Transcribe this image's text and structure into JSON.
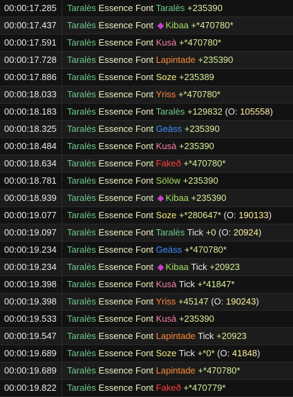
{
  "colors": {
    "Taralès": "#71c78d",
    "Kibaa": "#a6df63",
    "Kusà": "#f87fb0",
    "Lapintade": "#ff8a3a",
    "Soze": "#f6ee7d",
    "Yriss": "#ff8a3a",
    "Geäss": "#3d8eff",
    "Fakeð": "#ff4040",
    "Sölöw": "#a6df63",
    "Taralès-target": "#71c78d"
  },
  "rows": [
    {
      "time": "00:00:17.285",
      "source": "Taralès",
      "spell": "Essence Font",
      "target": "Taralès",
      "target_icon": false,
      "tick": "",
      "amount": "+235390",
      "overheal_prefix": "",
      "overheal": "",
      "overheal_suffix": ""
    },
    {
      "time": "00:00:17.437",
      "source": "Taralès",
      "spell": "Essence Font",
      "target": "Kibaa",
      "target_icon": true,
      "tick": "",
      "amount": "+*470780*",
      "overheal_prefix": "",
      "overheal": "",
      "overheal_suffix": ""
    },
    {
      "time": "00:00:17.591",
      "source": "Taralès",
      "spell": "Essence Font",
      "target": "Kusà",
      "target_icon": false,
      "tick": "",
      "amount": "+*470780*",
      "overheal_prefix": "",
      "overheal": "",
      "overheal_suffix": ""
    },
    {
      "time": "00:00:17.728",
      "source": "Taralès",
      "spell": "Essence Font",
      "target": "Lapintade",
      "target_icon": false,
      "tick": "",
      "amount": "+235390",
      "overheal_prefix": "",
      "overheal": "",
      "overheal_suffix": ""
    },
    {
      "time": "00:00:17.886",
      "source": "Taralès",
      "spell": "Essence Font",
      "target": "Soze",
      "target_icon": false,
      "tick": "",
      "amount": "+235389",
      "overheal_prefix": "",
      "overheal": "",
      "overheal_suffix": ""
    },
    {
      "time": "00:00:18.033",
      "source": "Taralès",
      "spell": "Essence Font",
      "target": "Yriss",
      "target_icon": false,
      "tick": "",
      "amount": "+*470780*",
      "overheal_prefix": "",
      "overheal": "",
      "overheal_suffix": ""
    },
    {
      "time": "00:00:18.183",
      "source": "Taralès",
      "spell": "Essence Font",
      "target": "Taralès",
      "target_icon": false,
      "tick": "",
      "amount": "+129832",
      "overheal_prefix": " (O: ",
      "overheal": "105558",
      "overheal_suffix": ")"
    },
    {
      "time": "00:00:18.325",
      "source": "Taralès",
      "spell": "Essence Font",
      "target": "Geäss",
      "target_icon": false,
      "tick": "",
      "amount": "+235390",
      "overheal_prefix": "",
      "overheal": "",
      "overheal_suffix": ""
    },
    {
      "time": "00:00:18.484",
      "source": "Taralès",
      "spell": "Essence Font",
      "target": "Kusà",
      "target_icon": false,
      "tick": "",
      "amount": "+235390",
      "overheal_prefix": "",
      "overheal": "",
      "overheal_suffix": ""
    },
    {
      "time": "00:00:18.634",
      "source": "Taralès",
      "spell": "Essence Font",
      "target": "Fakeð",
      "target_icon": false,
      "tick": "",
      "amount": "+*470780*",
      "overheal_prefix": "",
      "overheal": "",
      "overheal_suffix": ""
    },
    {
      "time": "00:00:18.781",
      "source": "Taralès",
      "spell": "Essence Font",
      "target": "Sölöw",
      "target_icon": false,
      "tick": "",
      "amount": "+235390",
      "overheal_prefix": "",
      "overheal": "",
      "overheal_suffix": ""
    },
    {
      "time": "00:00:18.939",
      "source": "Taralès",
      "spell": "Essence Font",
      "target": "Kibaa",
      "target_icon": true,
      "tick": "",
      "amount": "+235390",
      "overheal_prefix": "",
      "overheal": "",
      "overheal_suffix": ""
    },
    {
      "time": "00:00:19.077",
      "source": "Taralès",
      "spell": "Essence Font",
      "target": "Soze",
      "target_icon": false,
      "tick": "",
      "amount": "+*280647*",
      "overheal_prefix": " (O: ",
      "overheal": "190133",
      "overheal_suffix": ")"
    },
    {
      "time": "00:00:19.097",
      "source": "Taralès",
      "spell": "Essence Font",
      "target": "Taralès",
      "target_icon": false,
      "tick": "Tick",
      "amount": "+0",
      "overheal_prefix": " (O: ",
      "overheal": "20924",
      "overheal_suffix": ")"
    },
    {
      "time": "00:00:19.234",
      "source": "Taralès",
      "spell": "Essence Font",
      "target": "Geäss",
      "target_icon": false,
      "tick": "",
      "amount": "+*470780*",
      "overheal_prefix": "",
      "overheal": "",
      "overheal_suffix": ""
    },
    {
      "time": "00:00:19.234",
      "source": "Taralès",
      "spell": "Essence Font",
      "target": "Kibaa",
      "target_icon": true,
      "tick": "Tick",
      "amount": "+20923",
      "overheal_prefix": "",
      "overheal": "",
      "overheal_suffix": ""
    },
    {
      "time": "00:00:19.398",
      "source": "Taralès",
      "spell": "Essence Font",
      "target": "Kusà",
      "target_icon": false,
      "tick": "Tick",
      "amount": "+*41847*",
      "overheal_prefix": "",
      "overheal": "",
      "overheal_suffix": ""
    },
    {
      "time": "00:00:19.398",
      "source": "Taralès",
      "spell": "Essence Font",
      "target": "Yriss",
      "target_icon": false,
      "tick": "",
      "amount": "+45147",
      "overheal_prefix": " (O: ",
      "overheal": "190243",
      "overheal_suffix": ")"
    },
    {
      "time": "00:00:19.533",
      "source": "Taralès",
      "spell": "Essence Font",
      "target": "Kusà",
      "target_icon": false,
      "tick": "",
      "amount": "+235390",
      "overheal_prefix": "",
      "overheal": "",
      "overheal_suffix": ""
    },
    {
      "time": "00:00:19.547",
      "source": "Taralès",
      "spell": "Essence Font",
      "target": "Lapintade",
      "target_icon": false,
      "tick": "Tick",
      "amount": "+20923",
      "overheal_prefix": "",
      "overheal": "",
      "overheal_suffix": ""
    },
    {
      "time": "00:00:19.689",
      "source": "Taralès",
      "spell": "Essence Font",
      "target": "Soze",
      "target_icon": false,
      "tick": "Tick",
      "amount": "+*0*",
      "overheal_prefix": " (O: ",
      "overheal": "41848",
      "overheal_suffix": ")"
    },
    {
      "time": "00:00:19.689",
      "source": "Taralès",
      "spell": "Essence Font",
      "target": "Lapintade",
      "target_icon": false,
      "tick": "",
      "amount": "+*470780*",
      "overheal_prefix": "",
      "overheal": "",
      "overheal_suffix": ""
    },
    {
      "time": "00:00:19.822",
      "source": "Taralès",
      "spell": "Essence Font",
      "target": "Fakeð",
      "target_icon": false,
      "tick": "",
      "amount": "+*470779*",
      "overheal_prefix": "",
      "overheal": "",
      "overheal_suffix": ""
    }
  ]
}
